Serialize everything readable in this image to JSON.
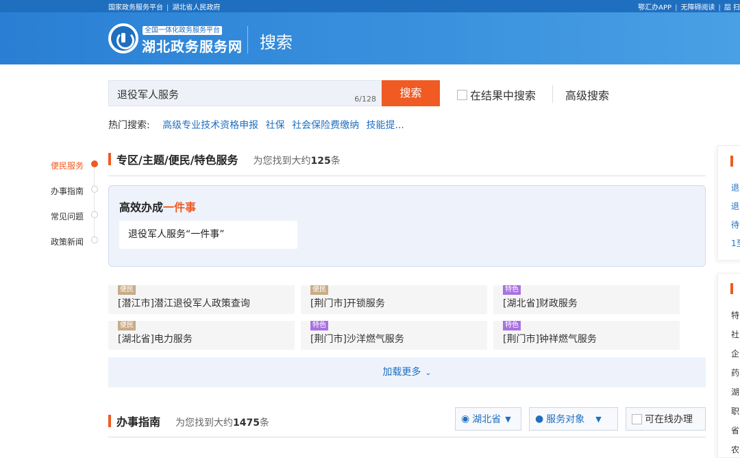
{
  "topbar": {
    "left_1": "国家政务服务平台",
    "left_2": "湖北省人民政府",
    "right_1": "鄂汇办APP",
    "right_2": "无障碍阅读",
    "right_3": "㗊 扫"
  },
  "header": {
    "logo_tag": "全国一体化政务服务平台",
    "logo_name": "湖北政务服务网",
    "title": "搜索"
  },
  "search": {
    "value": "退役军人服务",
    "count": "6/128",
    "button": "搜索",
    "in_results": "在结果中搜索",
    "advanced": "高级搜索"
  },
  "hot": {
    "label": "热门搜索:",
    "items": [
      "高级专业技术资格申报",
      "社保",
      "社会保险费缴纳",
      "技能提..."
    ]
  },
  "side_nav": {
    "items": [
      "便民服务",
      "办事指南",
      "常见问题",
      "政策新闻"
    ]
  },
  "section1": {
    "title": "专区/主题/便民/特色服务",
    "count_prefix": "为您找到大约",
    "count": "125",
    "count_suffix": "条"
  },
  "featured": {
    "title_a": "高效办成",
    "title_b": "一件事",
    "card": "退役军人服务“一件事”"
  },
  "services": [
    {
      "tag": "便民",
      "name": "[潜江市]潜江退役军人政策查询"
    },
    {
      "tag": "便民",
      "name": "[荆门市]开锁服务"
    },
    {
      "tag": "特色",
      "name": "[湖北省]财政服务"
    },
    {
      "tag": "便民",
      "name": "[湖北省]电力服务"
    },
    {
      "tag": "特色",
      "name": "[荆门市]沙洋燃气服务"
    },
    {
      "tag": "特色",
      "name": "[荆门市]钟祥燃气服务"
    }
  ],
  "load_more": "加载更多",
  "section2": {
    "title": "办事指南",
    "count_prefix": "为您找到大约",
    "count": "1475",
    "count_suffix": "条",
    "filter_region": "湖北省",
    "filter_target": "服务对象",
    "filter_online": "可在线办理"
  },
  "right_panel": {
    "card1_lines": [
      "退",
      "退",
      "待",
      "1至"
    ],
    "card2_lines": [
      "特",
      "社",
      "企",
      "药",
      "湖",
      "职",
      "省",
      "农"
    ]
  },
  "colors": {
    "brand_blue": "#1f6fc0",
    "accent_orange": "#f05a23",
    "tag_bianmin": "#c9ab86",
    "tag_tese": "#a871e0"
  }
}
